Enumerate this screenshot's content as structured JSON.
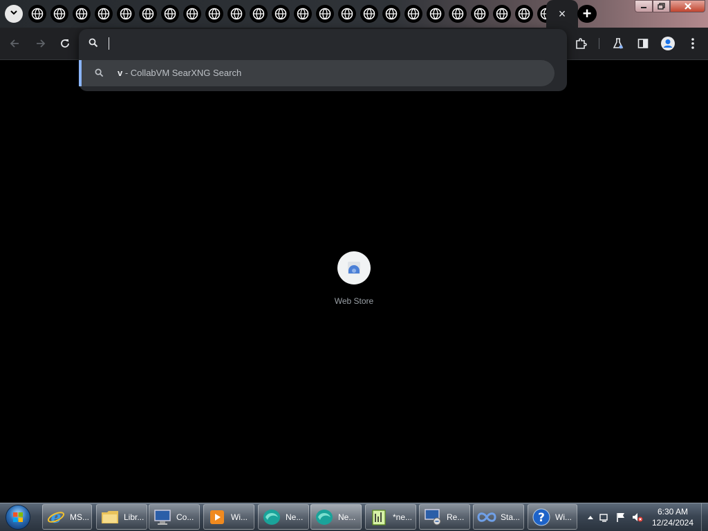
{
  "browser": {
    "tab_count": 24,
    "active_tab_close_glyph": "×",
    "new_tab_glyph": "+",
    "tab_favicon": "globe-icon"
  },
  "omnibox": {
    "value": "",
    "suggestion": {
      "query": "v",
      "separator": " - ",
      "engine": "CollabVM SearXNG Search"
    }
  },
  "page": {
    "shortcuts": [
      {
        "label": "Web Store",
        "icon": "web-store-icon"
      }
    ]
  },
  "taskbar": {
    "buttons": [
      {
        "label": "MS...",
        "icon": "internet-explorer-icon",
        "active": false
      },
      {
        "label": "Libr...",
        "icon": "folder-icon",
        "active": false
      },
      {
        "label": "Co...",
        "icon": "computer-icon",
        "active": false
      },
      {
        "label": "Wi...",
        "icon": "media-player-icon",
        "active": false
      },
      {
        "label": "Ne...",
        "icon": "browser-icon",
        "active": false
      },
      {
        "label": "Ne...",
        "icon": "browser-icon",
        "active": true
      },
      {
        "label": "*ne...",
        "icon": "notepad-icon",
        "active": false
      },
      {
        "label": "Re...",
        "icon": "remote-desktop-icon",
        "active": false
      },
      {
        "label": "Sta...",
        "icon": "infinity-icon",
        "active": false
      },
      {
        "label": "Wi...",
        "icon": "help-icon",
        "active": false
      }
    ],
    "clock_time": "6:30 AM",
    "clock_date": "12/24/2024"
  },
  "colors": {
    "accent": "#8ab4f8",
    "toolbar_bg": "#202124",
    "page_bg": "#000000"
  }
}
